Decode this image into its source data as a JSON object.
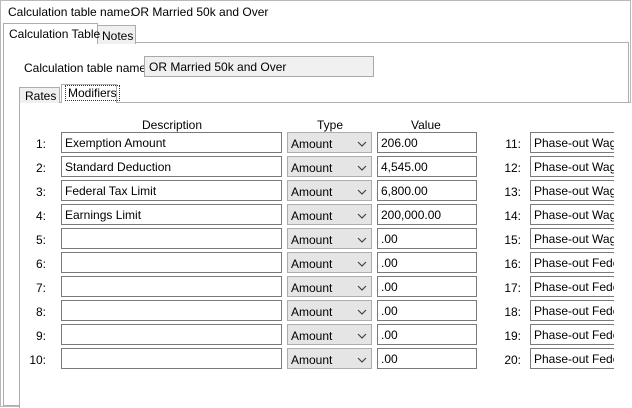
{
  "header": {
    "label": "Calculation table name:",
    "value": "OR Married 50k and Over"
  },
  "outer_tabs": [
    {
      "label": "Calculation Table"
    },
    {
      "label": "Notes"
    }
  ],
  "form": {
    "label": "Calculation table name:",
    "value": "OR Married 50k and Over"
  },
  "inner_tabs": [
    {
      "label": "Rates"
    },
    {
      "label": "Modifiers"
    }
  ],
  "columns": {
    "description": "Description",
    "type": "Type",
    "value": "Value"
  },
  "rows": [
    {
      "num": "1:",
      "description": "Exemption Amount",
      "type": "Amount",
      "value": "206.00"
    },
    {
      "num": "2:",
      "description": "Standard Deduction",
      "type": "Amount",
      "value": "4,545.00"
    },
    {
      "num": "3:",
      "description": "Federal Tax Limit",
      "type": "Amount",
      "value": "6,800.00"
    },
    {
      "num": "4:",
      "description": "Earnings Limit",
      "type": "Amount",
      "value": "200,000.00"
    },
    {
      "num": "5:",
      "description": "",
      "type": "Amount",
      "value": ".00"
    },
    {
      "num": "6:",
      "description": "",
      "type": "Amount",
      "value": ".00"
    },
    {
      "num": "7:",
      "description": "",
      "type": "Amount",
      "value": ".00"
    },
    {
      "num": "8:",
      "description": "",
      "type": "Amount",
      "value": ".00"
    },
    {
      "num": "9:",
      "description": "",
      "type": "Amount",
      "value": ".00"
    },
    {
      "num": "10:",
      "description": "",
      "type": "Amount",
      "value": ".00"
    }
  ],
  "right_rows": [
    {
      "num": "11:",
      "description": "Phase-out Wage"
    },
    {
      "num": "12:",
      "description": "Phase-out Wage"
    },
    {
      "num": "13:",
      "description": "Phase-out Wage"
    },
    {
      "num": "14:",
      "description": "Phase-out Wage"
    },
    {
      "num": "15:",
      "description": "Phase-out Wage"
    },
    {
      "num": "16:",
      "description": "Phase-out Feder"
    },
    {
      "num": "17:",
      "description": "Phase-out Feder"
    },
    {
      "num": "18:",
      "description": "Phase-out Feder"
    },
    {
      "num": "19:",
      "description": "Phase-out Feder"
    },
    {
      "num": "20:",
      "description": "Phase-out Feder"
    }
  ],
  "icons": {
    "dropdown": "chevron-down-icon"
  }
}
